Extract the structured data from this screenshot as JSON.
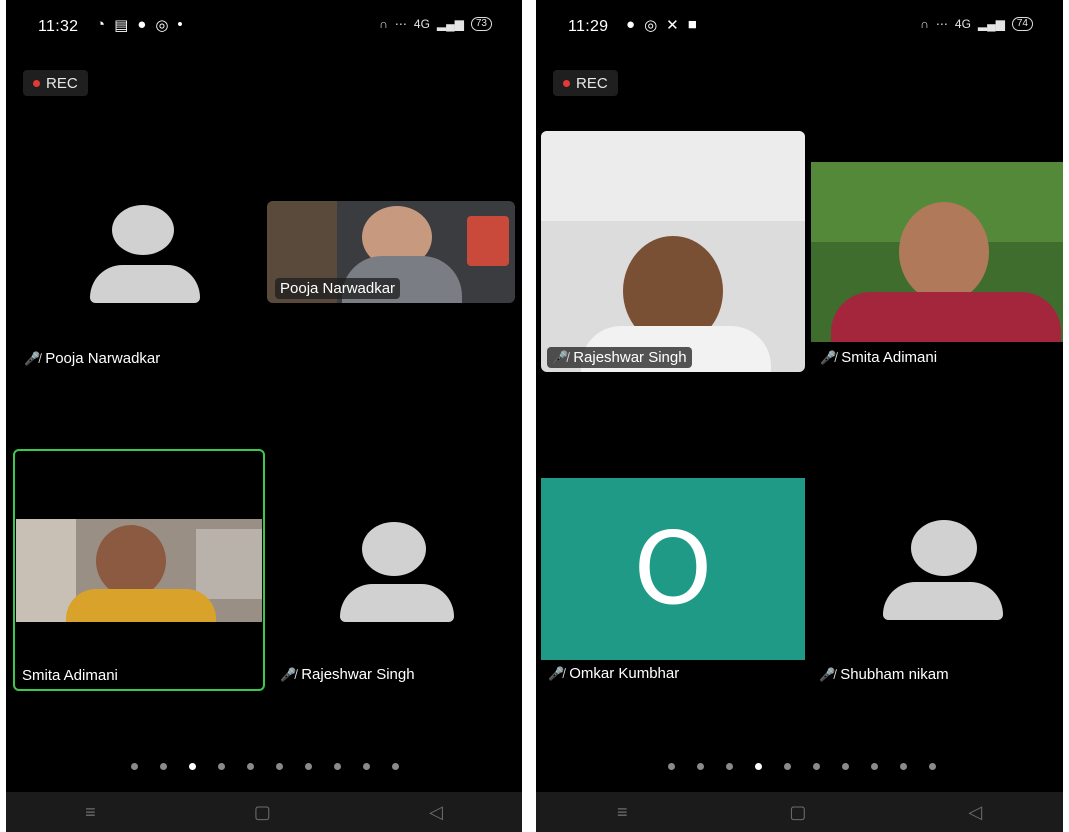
{
  "left": {
    "status": {
      "time": "11:32",
      "battery": "73",
      "network": "4G"
    },
    "rec_label": "REC",
    "tiles": {
      "t1": {
        "name": "Pooja Narwadkar"
      },
      "t2": {
        "name": "Pooja Narwadkar"
      },
      "t3": {
        "name": "Smita Adimani"
      },
      "t4": {
        "name": "Rajeshwar Singh"
      }
    },
    "page_dots": {
      "count": 10,
      "active": 2
    }
  },
  "right": {
    "status": {
      "time": "11:29",
      "battery": "74",
      "network": "4G"
    },
    "rec_label": "REC",
    "tiles": {
      "t1": {
        "name": "Rajeshwar Singh"
      },
      "t2": {
        "name": "Smita Adimani"
      },
      "t3": {
        "name": "Omkar Kumbhar",
        "initial": "O"
      },
      "t4": {
        "name": "Shubham nikam"
      }
    },
    "page_dots": {
      "count": 10,
      "active": 3
    }
  },
  "colors": {
    "active_speaker_border": "#3ec84b",
    "initial_tile": "#1f9a86",
    "rec_dot": "#e53935"
  },
  "navbar": {
    "menu": "≡",
    "home": "▢",
    "back": "◁"
  }
}
